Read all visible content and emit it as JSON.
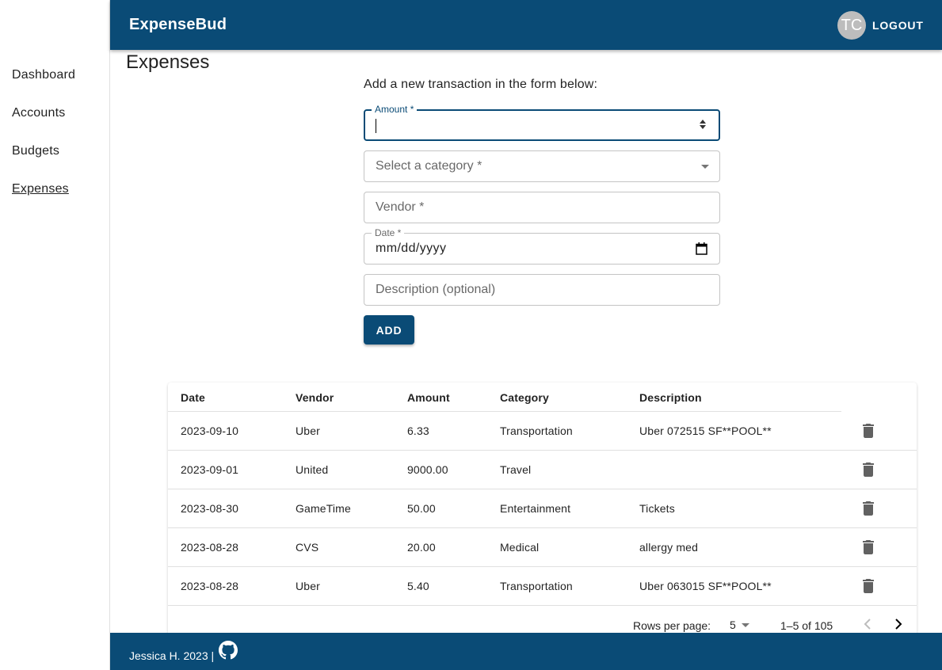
{
  "app": {
    "brand": "ExpenseBud",
    "avatar_initials": "TC",
    "logout_label": "LOGOUT"
  },
  "sidebar": {
    "items": [
      {
        "label": "Dashboard"
      },
      {
        "label": "Accounts"
      },
      {
        "label": "Budgets"
      },
      {
        "label": "Expenses",
        "active": true
      }
    ]
  },
  "page": {
    "title": "Expenses",
    "form_intro": "Add a new transaction in the form below:"
  },
  "form": {
    "amount": {
      "label": "Amount *",
      "value": ""
    },
    "category": {
      "placeholder": "Select a category *"
    },
    "vendor": {
      "placeholder": "Vendor *"
    },
    "date": {
      "label": "Date *",
      "value": "mm/dd/yyyy"
    },
    "description": {
      "placeholder": "Description (optional)"
    },
    "add_label": "ADD"
  },
  "table": {
    "columns": [
      "Date",
      "Vendor",
      "Amount",
      "Category",
      "Description"
    ],
    "rows": [
      {
        "date": "2023-09-10",
        "vendor": "Uber",
        "amount": "6.33",
        "category": "Transportation",
        "description": "Uber 072515 SF**POOL**"
      },
      {
        "date": "2023-09-01",
        "vendor": "United",
        "amount": "9000.00",
        "category": "Travel",
        "description": ""
      },
      {
        "date": "2023-08-30",
        "vendor": "GameTime",
        "amount": "50.00",
        "category": "Entertainment",
        "description": "Tickets"
      },
      {
        "date": "2023-08-28",
        "vendor": "CVS",
        "amount": "20.00",
        "category": "Medical",
        "description": "allergy med"
      },
      {
        "date": "2023-08-28",
        "vendor": "Uber",
        "amount": "5.40",
        "category": "Transportation",
        "description": "Uber 063015 SF**POOL**"
      }
    ],
    "pagination": {
      "rows_per_page_label": "Rows per page:",
      "rows_per_page_value": "5",
      "range": "1–5 of 105"
    }
  },
  "footer": {
    "text": "Jessica H. 2023 |"
  },
  "colors": {
    "primary": "#0a4b76",
    "avatar_bg": "#bdbdbd"
  },
  "icons": [
    "trash-icon",
    "github-icon",
    "calendar-icon",
    "chevron-left-icon",
    "chevron-right-icon",
    "dropdown-arrow-icon"
  ]
}
